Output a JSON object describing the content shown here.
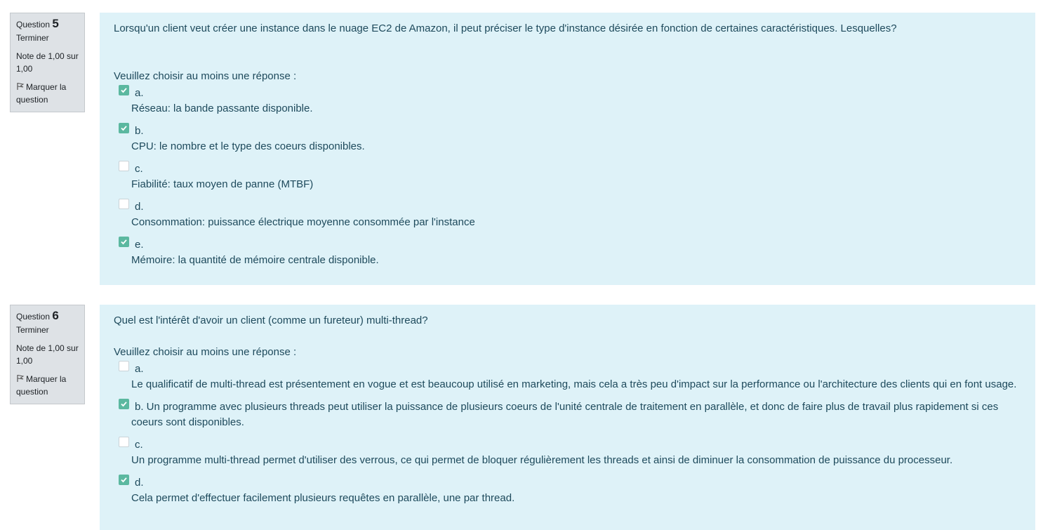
{
  "q5": {
    "label": "Question",
    "number": "5",
    "state": "Terminer",
    "grade": "Note de 1,00 sur 1,00",
    "flag": "Marquer la question",
    "text": "Lorsqu'un client veut créer une instance dans le nuage EC2 de Amazon, il peut préciser le type d'instance désirée en fonction de certaines caractéristiques. Lesquelles?",
    "prompt": "Veuillez choisir au moins une réponse :",
    "options": [
      {
        "letter": "a.",
        "text": "Réseau: la bande passante disponible.",
        "checked": true
      },
      {
        "letter": "b.",
        "text": "CPU: le nombre et le type des coeurs disponibles.",
        "checked": true
      },
      {
        "letter": "c.",
        "text": "Fiabilité: taux moyen de panne (MTBF)",
        "checked": false
      },
      {
        "letter": "d.",
        "text": "Consommation: puissance électrique moyenne consommée par l'instance",
        "checked": false
      },
      {
        "letter": "e.",
        "text": "Mémoire: la quantité de mémoire centrale disponible.",
        "checked": true
      }
    ]
  },
  "q6": {
    "label": "Question",
    "number": "6",
    "state": "Terminer",
    "grade": "Note de 1,00 sur 1,00",
    "flag": "Marquer la question",
    "text": "Quel est l'intérêt d'avoir un client (comme un fureteur) multi-thread?",
    "prompt": "Veuillez choisir au moins une réponse :",
    "options": [
      {
        "letter": "a.",
        "text": "Le qualificatif de multi-thread est présentement en vogue et est beaucoup utilisé en marketing, mais cela a très peu d'impact sur la performance ou l'architecture des clients qui en font usage.",
        "checked": false
      },
      {
        "letter": "b.",
        "text": "Un programme avec plusieurs threads peut utiliser la puissance de plusieurs coeurs de l'unité centrale de traitement en parallèle, et donc de faire plus de travail plus rapidement si ces coeurs sont disponibles.",
        "checked": true
      },
      {
        "letter": "c.",
        "text": "Un programme multi-thread permet d'utiliser des verrous, ce qui permet de bloquer régulièrement les threads et ainsi de diminuer la consommation de puissance du processeur.",
        "checked": false
      },
      {
        "letter": "d.",
        "text": "Cela permet d'effectuer facilement plusieurs requêtes en parallèle, une par thread.",
        "checked": true
      }
    ]
  }
}
